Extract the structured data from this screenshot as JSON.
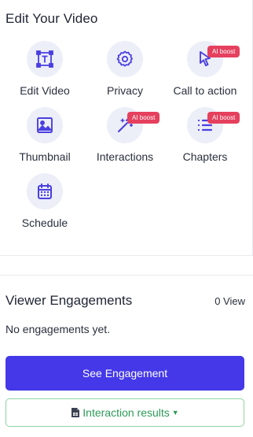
{
  "section": {
    "title": "Edit Your Video"
  },
  "colors": {
    "accent": "#4438e8",
    "icon": "#4a3fe0",
    "icon_bg": "#eceef8",
    "badge": "#e5405e",
    "success": "#2e9a58"
  },
  "tiles": [
    {
      "label": "Edit Video",
      "icon": "text-frame-icon"
    },
    {
      "label": "Privacy",
      "icon": "gear-icon"
    },
    {
      "label": "Call to action",
      "icon": "cursor-icon",
      "badge": "AI boost"
    },
    {
      "label": "Thumbnail",
      "icon": "image-icon"
    },
    {
      "label": "Interactions",
      "icon": "magic-wand-icon",
      "badge": "AI boost"
    },
    {
      "label": "Chapters",
      "icon": "list-icon",
      "badge": "AI boost"
    },
    {
      "label": "Schedule",
      "icon": "calendar-icon"
    }
  ],
  "engagements": {
    "title": "Viewer Engagements",
    "count": "0 View",
    "empty_text": "No engagements yet.",
    "see_button": "See Engagement",
    "results_button": "Interaction results"
  }
}
